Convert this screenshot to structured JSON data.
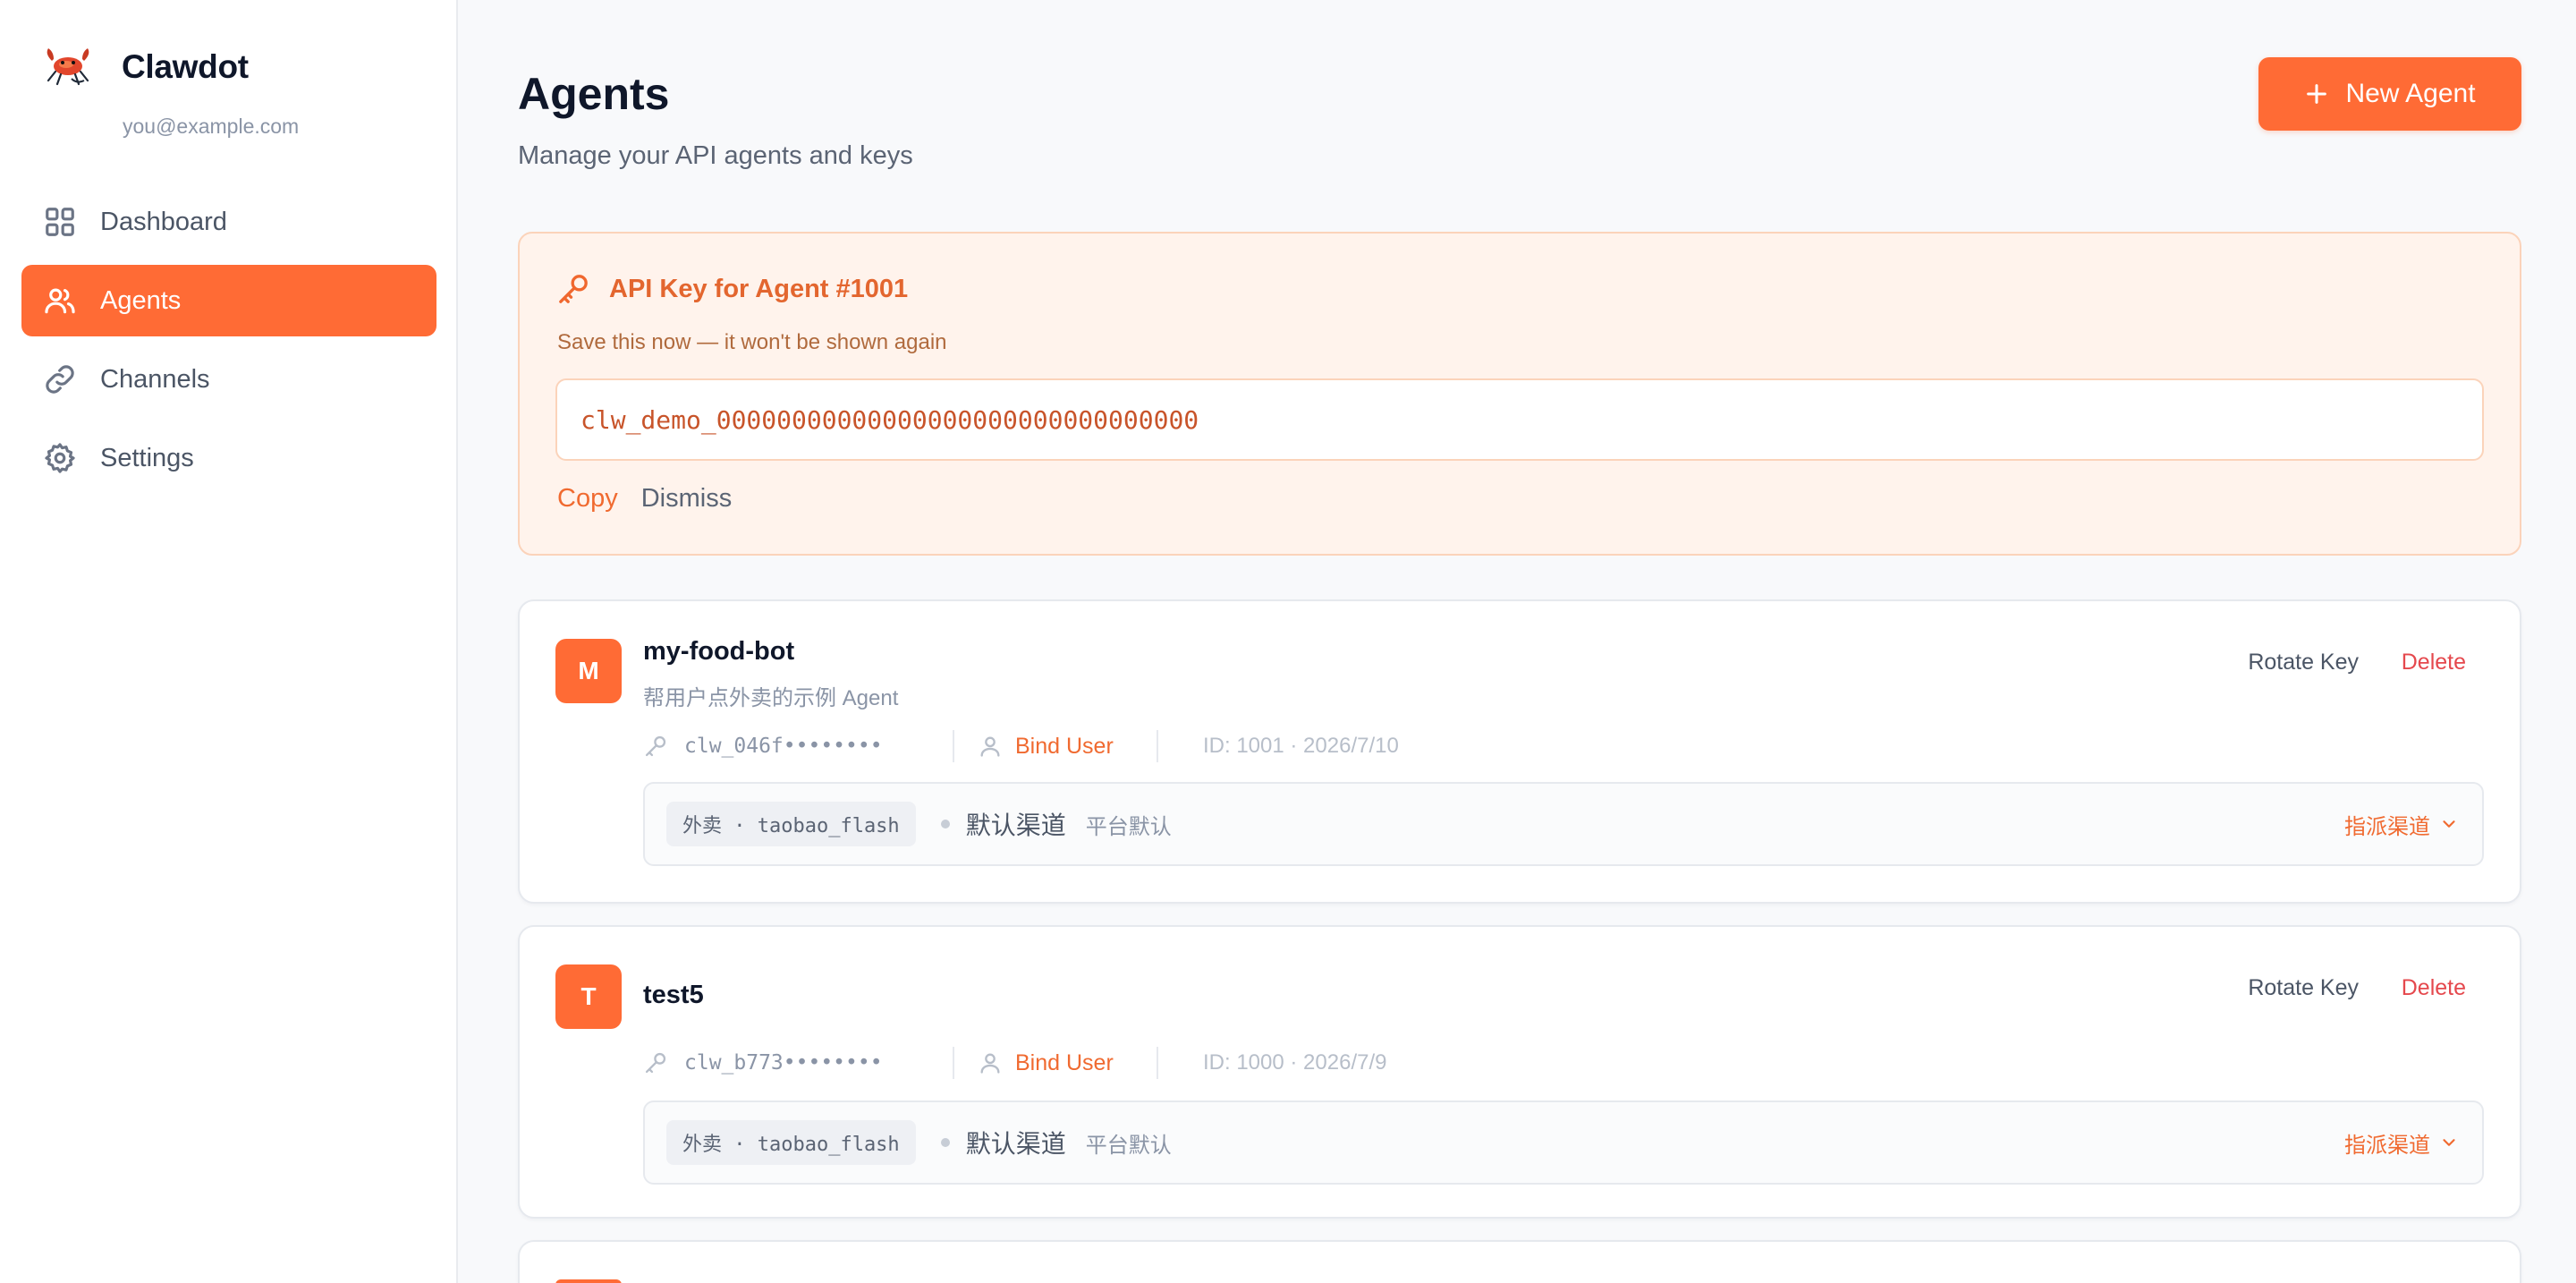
{
  "brand": {
    "name": "Clawdot",
    "email": "you@example.com",
    "accent": "#ff6b35"
  },
  "nav": {
    "items": [
      {
        "label": "Dashboard",
        "icon": "grid-icon",
        "active": false
      },
      {
        "label": "Agents",
        "icon": "users-icon",
        "active": true
      },
      {
        "label": "Channels",
        "icon": "link-icon",
        "active": false
      },
      {
        "label": "Settings",
        "icon": "gear-icon",
        "active": false
      }
    ]
  },
  "header": {
    "title": "Agents",
    "subtitle": "Manage your API agents and keys",
    "new_agent_label": "New Agent"
  },
  "api_key": {
    "title": "API Key for Agent #1001",
    "warning": "Save this now — it won't be shown again",
    "value": "clw_demo_00000000000000000000000000000000",
    "copy_label": "Copy",
    "dismiss_label": "Dismiss"
  },
  "agents": [
    {
      "initial": "M",
      "name": "my-food-bot",
      "description": "帮用户点外卖的示例 Agent",
      "key_prefix": "clw_046f••••••••",
      "bind_user_label": "Bind User",
      "meta": "ID: 1001 · 2026/7/10",
      "rotate_label": "Rotate Key",
      "delete_label": "Delete",
      "channel": {
        "tag": "外卖 · taobao_flash",
        "name": "默认渠道",
        "sub": "平台默认",
        "assign_label": "指派渠道"
      }
    },
    {
      "initial": "T",
      "name": "test5",
      "description": "",
      "key_prefix": "clw_b773••••••••",
      "bind_user_label": "Bind User",
      "meta": "ID: 1000 · 2026/7/9",
      "rotate_label": "Rotate Key",
      "delete_label": "Delete",
      "channel": {
        "tag": "外卖 · taobao_flash",
        "name": "默认渠道",
        "sub": "平台默认",
        "assign_label": "指派渠道"
      }
    }
  ]
}
